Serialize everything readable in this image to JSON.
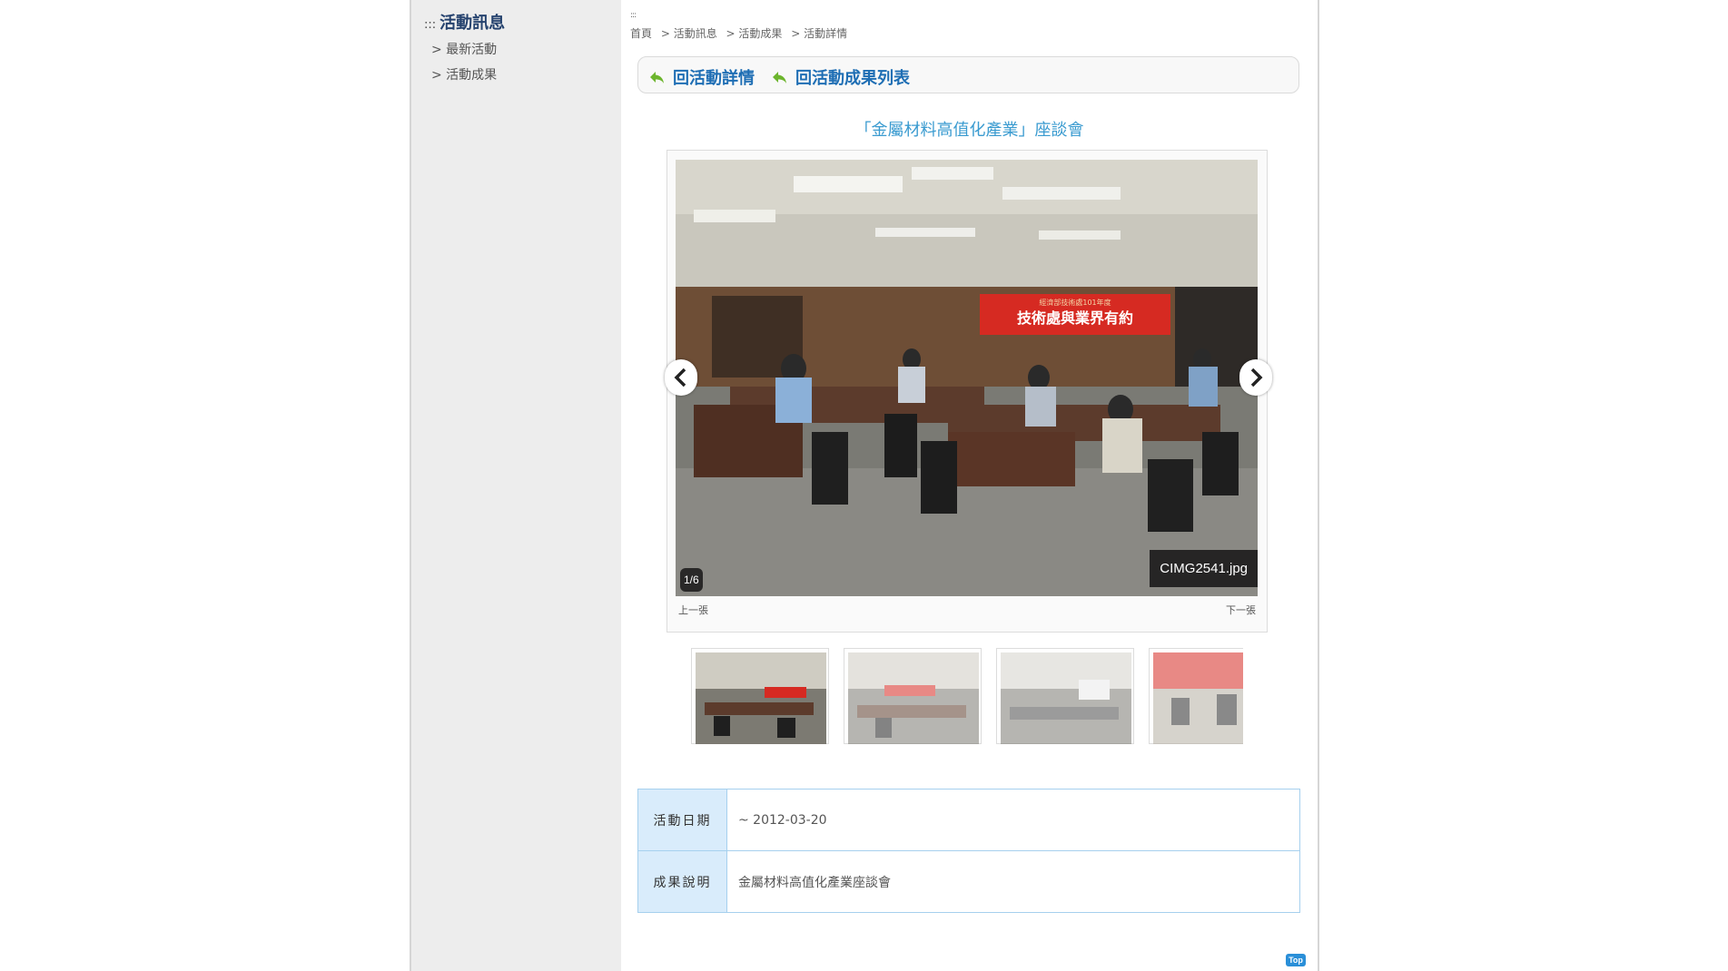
{
  "sidebar": {
    "title_prefix": ":::",
    "title": "活動訊息",
    "items": [
      {
        "label": "> 最新活動"
      },
      {
        "label": "> 活動成果"
      }
    ]
  },
  "breadcrumb": {
    "marker": ":::",
    "items": [
      "首頁",
      "> 活動訊息",
      "> 活動成果",
      "> 活動詳情"
    ]
  },
  "back_links": [
    {
      "label": "回活動詳情"
    },
    {
      "label": "回活動成果列表"
    }
  ],
  "event": {
    "title": "「金屬材料高值化產業」座談會"
  },
  "viewer": {
    "caption": "CIMG2541.jpg",
    "counter": "1/6",
    "prev_label": "上一張",
    "next_label": "下一張",
    "banner_lines": [
      "經濟部技術處101年度",
      "技術處與業界有約"
    ]
  },
  "info": {
    "rows": [
      {
        "label": "活動日期",
        "value": "~ 2012-03-20"
      },
      {
        "label": "成果說明",
        "value": "金屬材料高值化產業座談會"
      }
    ]
  },
  "top_button": "Top",
  "colors": {
    "accent": "#1e6eb4",
    "title": "#3a9bd0",
    "table_label_bg": "#d9ecfb",
    "sidebar_bg": "#ededed",
    "banner_red": "#d62a22"
  }
}
